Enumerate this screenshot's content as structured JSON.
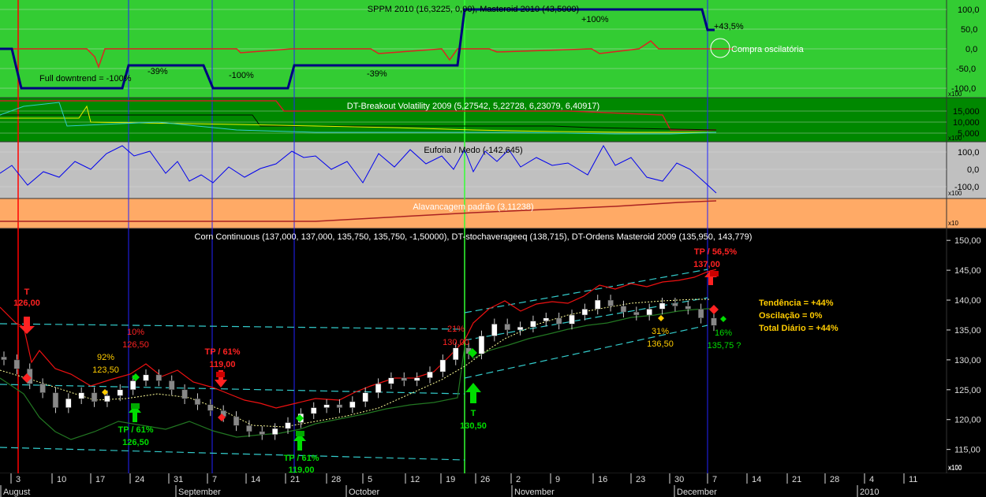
{
  "colors": {
    "green_panel": "#33cc33",
    "dark_green_panel": "#008800",
    "gray_panel": "#c0c0c0",
    "orange_panel": "#ffaa66",
    "price_bg": "#000000",
    "buy": "#00dd00",
    "sell": "#ff2222",
    "yellow_text": "#ffcc00",
    "cyan": "#33cccc",
    "navy": "#000080"
  },
  "panels": {
    "sppm": {
      "title": "SPPM 2010 (16,3225, 0,00), Masteroid 2010 (43,5000)",
      "ticks": [
        "100,0",
        "50,0",
        "0,0",
        "-50,0",
        "-100,0"
      ],
      "scale": "x100",
      "annotations": [
        "Full downtrend = -100%",
        "-39%",
        "-100%",
        "-39%",
        "+100%",
        "+43,5%",
        "Compra oscilatória"
      ]
    },
    "breakout": {
      "title": "DT-Breakout Volatility 2009 (5,27542, 5,22728, 6,23079, 6,40917)",
      "ticks": [
        "15,000",
        "10,000",
        "5,000"
      ],
      "scale": "x100"
    },
    "euforia": {
      "title": "Euforia / Medo (-142,645)",
      "ticks": [
        "100,0",
        "0,0",
        "-100,0"
      ],
      "scale": "x100"
    },
    "alavancagem": {
      "title": "Alavancagem padrão (3,11238)",
      "scale": "x10"
    },
    "price": {
      "title": "Corn Continuous (137,000, 137,000, 135,750, 135,750, -1,50000), DT-stochaverageeq (138,715), DT-Ordens Masteroid 2009 (135,950, 143,779)",
      "ticks": [
        "150,00",
        "145,00",
        "140,00",
        "135,00",
        "130,00",
        "125,00",
        "120,00",
        "115,00"
      ],
      "scale": "x100",
      "summary": [
        "Tendência = +44%",
        "Oscilação = 0%",
        "Total Diário = +44%"
      ]
    }
  },
  "xaxis": {
    "days": [
      "3",
      "10",
      "17",
      "24",
      "31",
      "7",
      "14",
      "21",
      "28",
      "5",
      "12",
      "19",
      "26",
      "2",
      "9",
      "16",
      "23",
      "30",
      "7",
      "14",
      "21",
      "28",
      "4",
      "11"
    ],
    "months": [
      "August",
      "September",
      "October",
      "November",
      "December",
      "2010"
    ],
    "scale": "x100"
  },
  "chart_data": {
    "type": "candlestick",
    "title": "Corn Continuous (137,000, 137,000, 135,750, 135,750, -1,50000), DT-stochaverageeq (138,715), DT-Ordens Masteroid 2009 (135,950, 143,779)",
    "ylim": [
      111,
      152
    ],
    "y_ticks": [
      150,
      145,
      140,
      135,
      130,
      125,
      120,
      115
    ],
    "close_series": [
      {
        "date": "Jul-28",
        "close": 130.0
      },
      {
        "date": "Jul-31",
        "close": 128.5
      },
      {
        "date": "Aug-3",
        "close": 126.0
      },
      {
        "date": "Aug-5",
        "close": 124.5
      },
      {
        "date": "Aug-7",
        "close": 122.0
      },
      {
        "date": "Aug-10",
        "close": 123.5
      },
      {
        "date": "Aug-12",
        "close": 124.5
      },
      {
        "date": "Aug-14",
        "close": 123.0
      },
      {
        "date": "Aug-17",
        "close": 124.0
      },
      {
        "date": "Aug-19",
        "close": 125.0
      },
      {
        "date": "Aug-21",
        "close": 126.5
      },
      {
        "date": "Aug-24",
        "close": 127.5
      },
      {
        "date": "Aug-26",
        "close": 126.5
      },
      {
        "date": "Aug-28",
        "close": 125.0
      },
      {
        "date": "Aug-31",
        "close": 123.5
      },
      {
        "date": "Sep-2",
        "close": 122.5
      },
      {
        "date": "Sep-4",
        "close": 121.5
      },
      {
        "date": "Sep-8",
        "close": 120.5
      },
      {
        "date": "Sep-10",
        "close": 119.0
      },
      {
        "date": "Sep-14",
        "close": 118.0
      },
      {
        "date": "Sep-16",
        "close": 117.5
      },
      {
        "date": "Sep-18",
        "close": 118.5
      },
      {
        "date": "Sep-21",
        "close": 119.5
      },
      {
        "date": "Sep-23",
        "close": 121.0
      },
      {
        "date": "Sep-25",
        "close": 122.0
      },
      {
        "date": "Sep-28",
        "close": 122.5
      },
      {
        "date": "Sep-30",
        "close": 122.0
      },
      {
        "date": "Oct-2",
        "close": 123.0
      },
      {
        "date": "Oct-5",
        "close": 124.5
      },
      {
        "date": "Oct-7",
        "close": 126.0
      },
      {
        "date": "Oct-9",
        "close": 127.0
      },
      {
        "date": "Oct-12",
        "close": 126.5
      },
      {
        "date": "Oct-14",
        "close": 127.0
      },
      {
        "date": "Oct-16",
        "close": 128.0
      },
      {
        "date": "Oct-19",
        "close": 130.0
      },
      {
        "date": "Oct-21",
        "close": 132.0
      },
      {
        "date": "Oct-23",
        "close": 131.0
      },
      {
        "date": "Oct-26",
        "close": 134.0
      },
      {
        "date": "Oct-28",
        "close": 136.0
      },
      {
        "date": "Oct-30",
        "close": 135.0
      },
      {
        "date": "Nov-2",
        "close": 135.5
      },
      {
        "date": "Nov-4",
        "close": 136.5
      },
      {
        "date": "Nov-6",
        "close": 137.0
      },
      {
        "date": "Nov-9",
        "close": 136.0
      },
      {
        "date": "Nov-11",
        "close": 137.5
      },
      {
        "date": "Nov-13",
        "close": 138.5
      },
      {
        "date": "Nov-16",
        "close": 140.0
      },
      {
        "date": "Nov-18",
        "close": 139.0
      },
      {
        "date": "Nov-20",
        "close": 138.0
      },
      {
        "date": "Nov-23",
        "close": 137.5
      },
      {
        "date": "Nov-25",
        "close": 138.5
      },
      {
        "date": "Nov-27",
        "close": 139.5
      },
      {
        "date": "Nov-30",
        "close": 139.0
      },
      {
        "date": "Dec-2",
        "close": 138.5
      },
      {
        "date": "Dec-4",
        "close": 137.0
      },
      {
        "date": "Dec-7",
        "close": 135.75
      }
    ],
    "signals": [
      {
        "label": "T",
        "price": "126,00",
        "kind": "sell"
      },
      {
        "label": "10%",
        "price": "126,50",
        "kind": "sell"
      },
      {
        "label": "92%",
        "price": "123,50",
        "kind": "osc"
      },
      {
        "label": "TP / 61%",
        "price": "126,50",
        "kind": "buy"
      },
      {
        "label": "TP / 61%",
        "price": "119,00",
        "kind": "sell"
      },
      {
        "label": "TP / 61%",
        "price": "119,00",
        "kind": "buy"
      },
      {
        "label": "21%",
        "price": "130,00",
        "kind": "sell"
      },
      {
        "label": "T",
        "price": "130,50",
        "kind": "buy"
      },
      {
        "label": "31%",
        "price": "136,50",
        "kind": "osc"
      },
      {
        "label": "TP / 56,5%",
        "price": "137,00",
        "kind": "sell"
      },
      {
        "label": "16%",
        "price": "135,75 ?",
        "kind": "buy"
      }
    ]
  }
}
